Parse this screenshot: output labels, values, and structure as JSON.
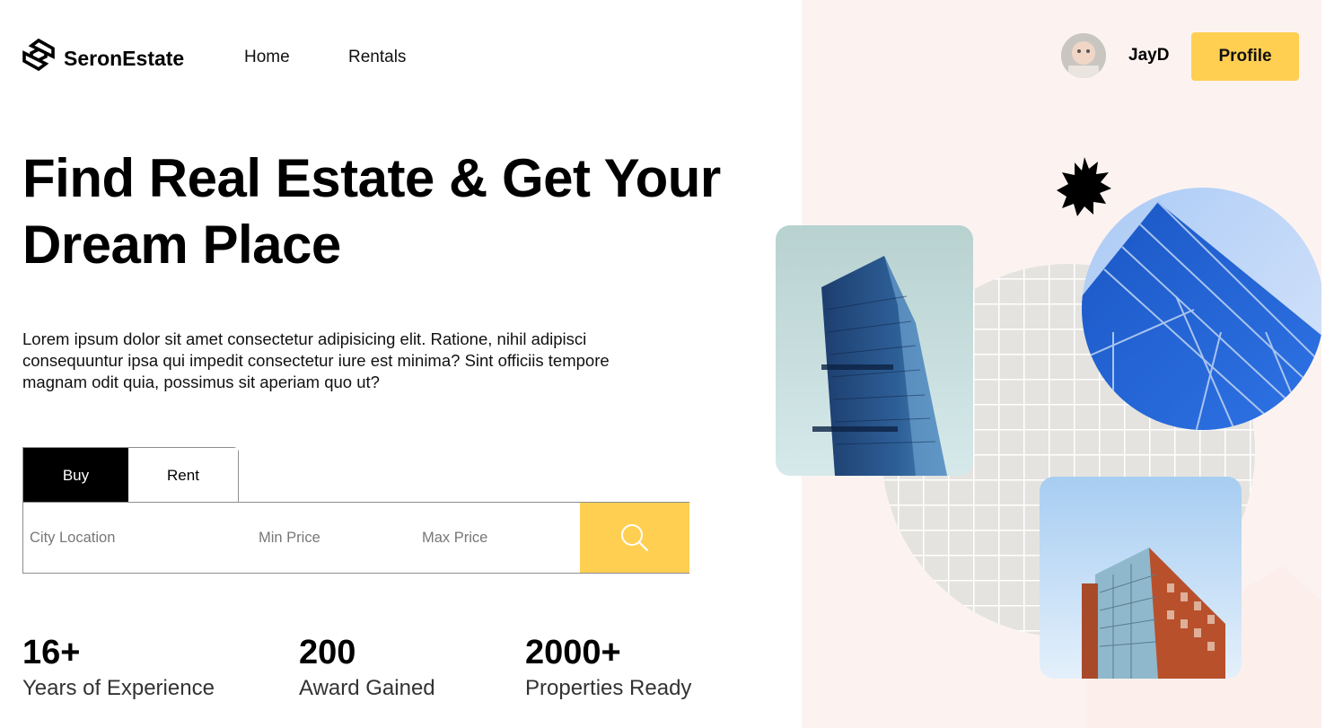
{
  "brand": {
    "name": "SeronEstate",
    "logo_icon": "logo-mark-icon"
  },
  "nav": {
    "items": [
      {
        "label": "Home"
      },
      {
        "label": "Rentals"
      }
    ]
  },
  "user": {
    "name": "JayD",
    "profile_button": "Profile"
  },
  "hero": {
    "title_line1": "Find Real Estate & Get Your",
    "title_line2": "Dream Place",
    "description": "Lorem ipsum dolor sit amet consectetur adipisicing elit. Ratione, nihil adipisci consequuntur ipsa qui impedit consectetur iure est minima? Sint officiis tempore magnam odit quia, possimus sit aperiam quo ut?"
  },
  "search": {
    "tabs": [
      {
        "label": "Buy",
        "active": true
      },
      {
        "label": "Rent",
        "active": false
      }
    ],
    "city_placeholder": "City Location",
    "min_placeholder": "Min Price",
    "max_placeholder": "Max Price",
    "button_icon": "search-icon"
  },
  "stats": [
    {
      "value": "16+",
      "label": "Years of Experience"
    },
    {
      "value": "200",
      "label": "Award Gained"
    },
    {
      "value": "2000+",
      "label": "Properties Ready"
    }
  ],
  "colors": {
    "accent": "#ffcf52",
    "panel_bg": "#fcf3f1",
    "text": "#000000",
    "tab_active_bg": "#000000"
  }
}
